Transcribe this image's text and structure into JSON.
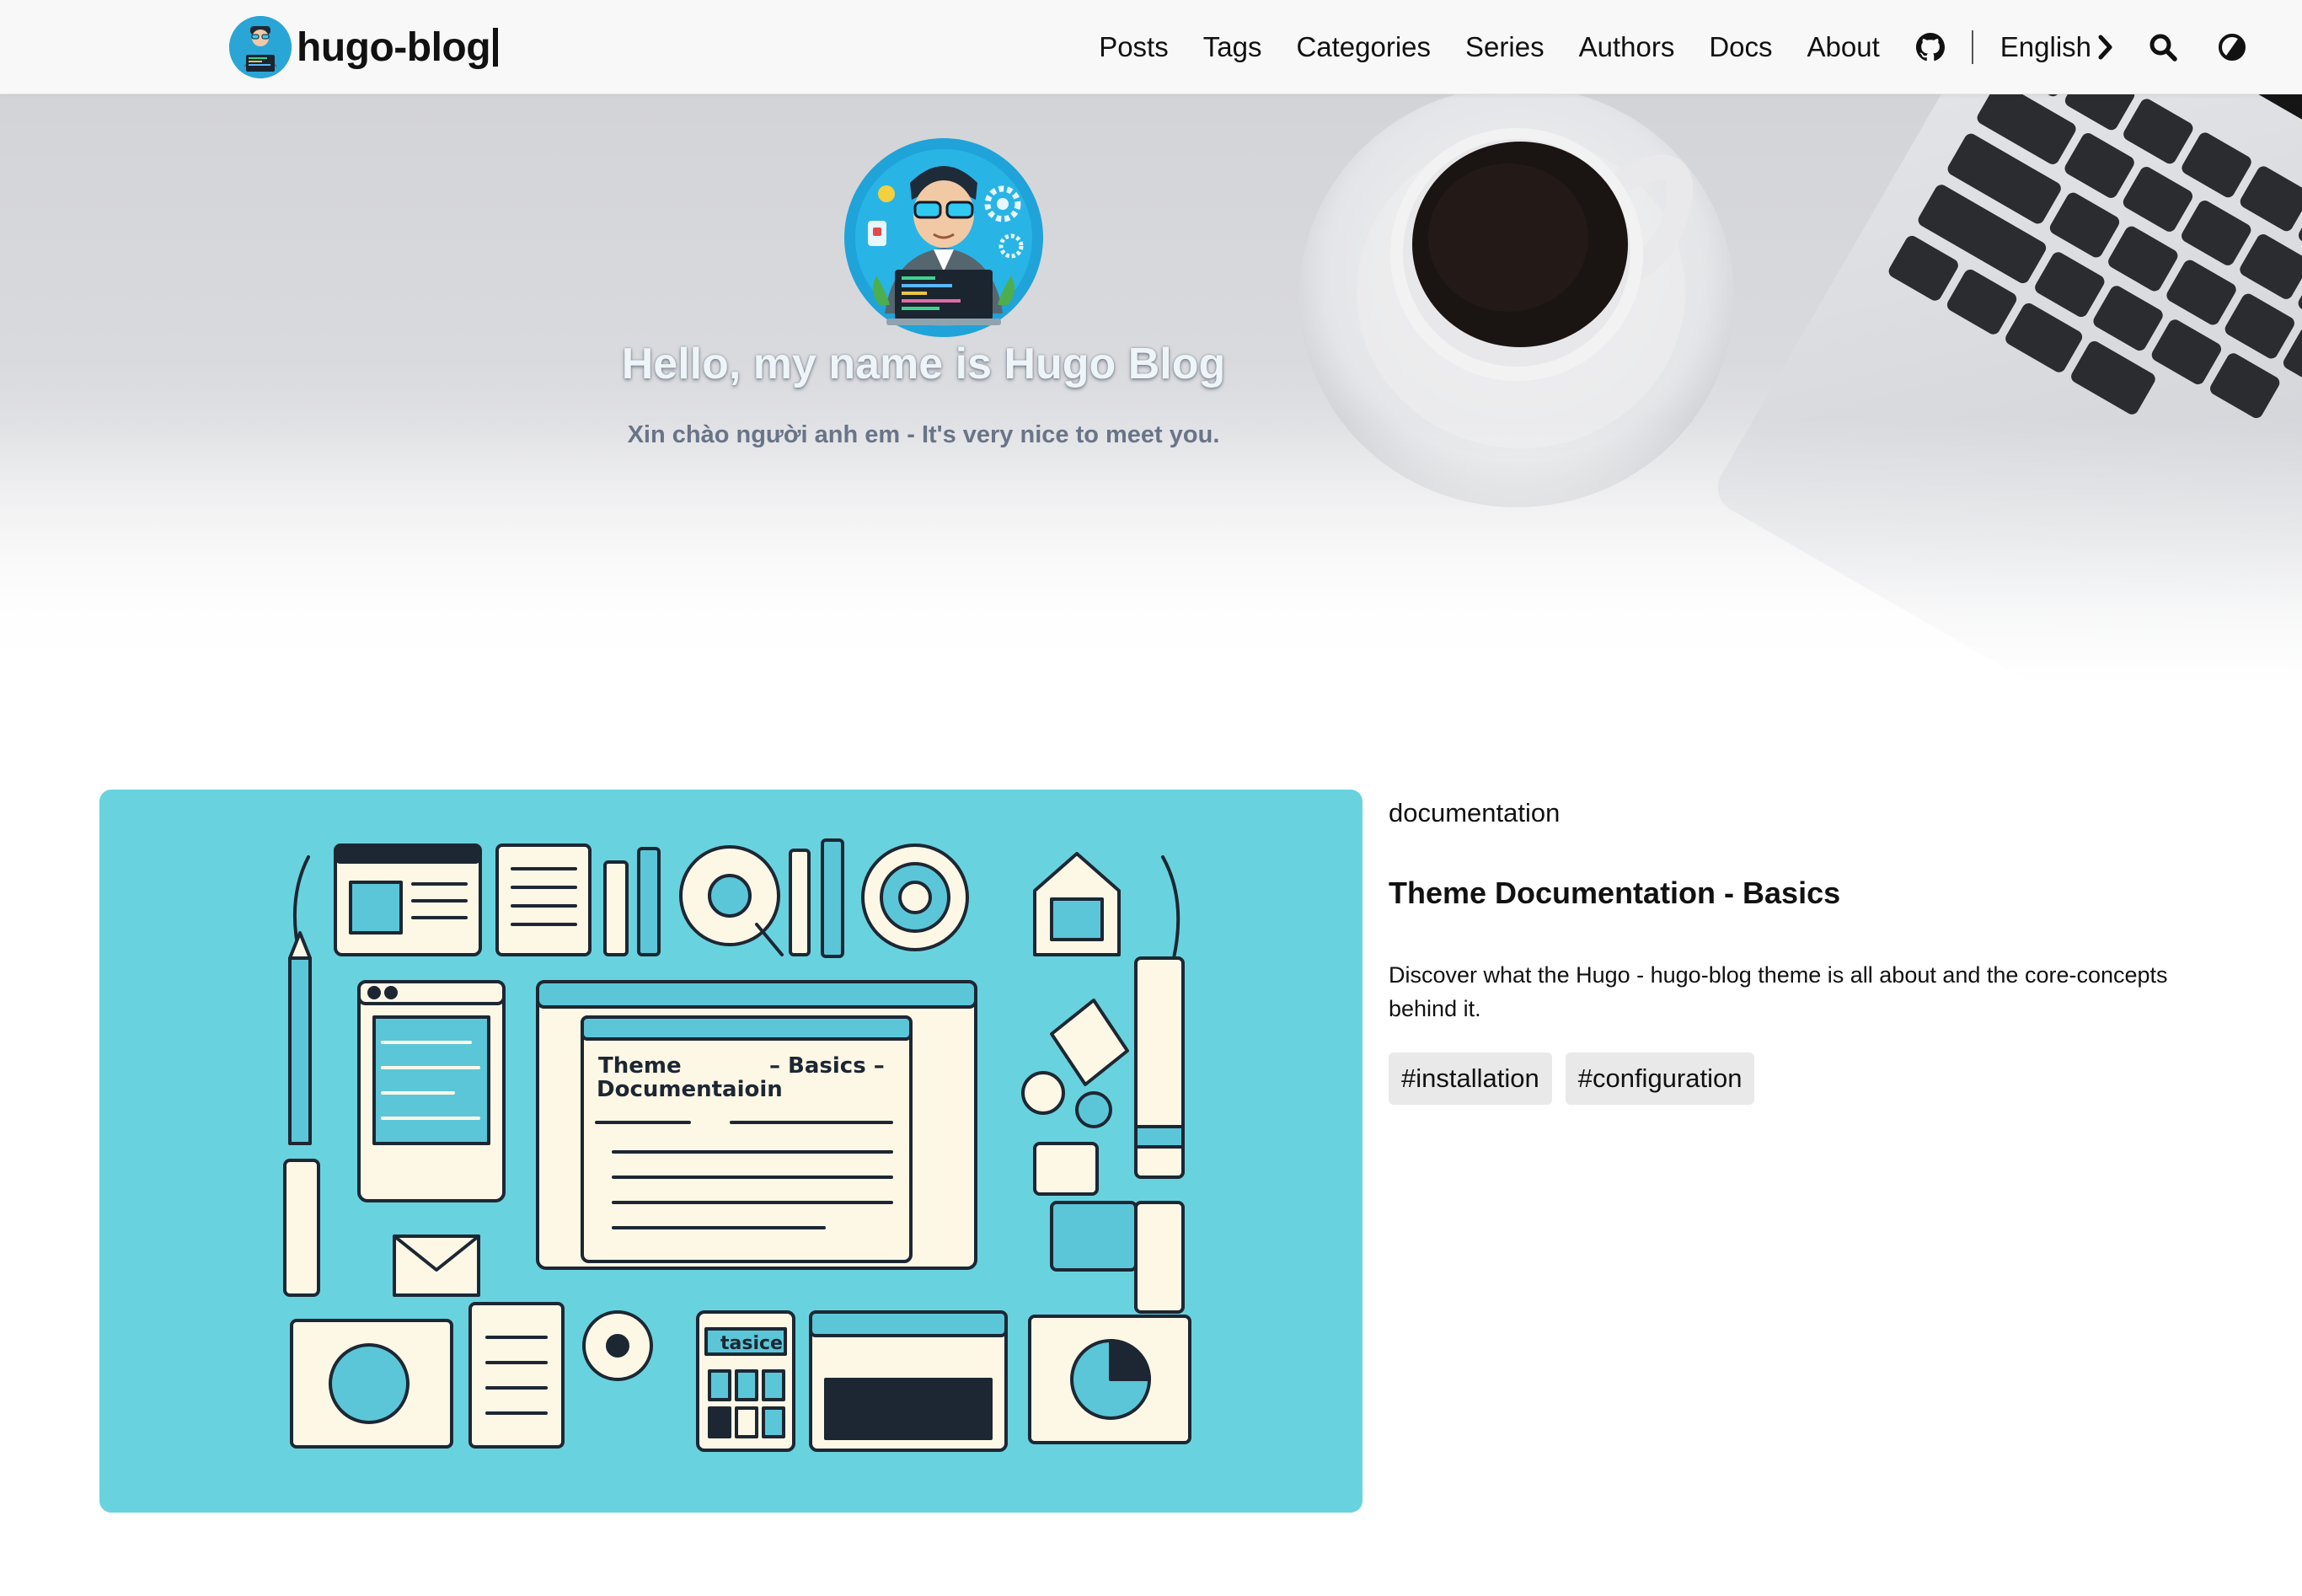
{
  "navbar": {
    "brand_title": "hugo-blog",
    "links": [
      "Posts",
      "Tags",
      "Categories",
      "Series",
      "Authors",
      "Docs",
      "About"
    ],
    "language": "English",
    "icons": [
      "github-icon",
      "chevron-right-icon",
      "search-icon",
      "theme-toggle-icon"
    ]
  },
  "hero": {
    "title": "Hello, my name is Hugo Blog",
    "subtitle": "Xin chào người anh em - It's very nice to meet you."
  },
  "post": {
    "category": "documentation",
    "title": "Theme Documentation - Basics",
    "summary": "Discover what the Hugo - hugo-blog theme is all about and the core-concepts behind it.",
    "tags": [
      "#installation",
      "#configuration"
    ],
    "image": {
      "heading_line1": "Theme",
      "heading_line2": "Documentaioin",
      "heading_right": "– Basics –",
      "card_label": "tasice",
      "background": "#68d3de"
    }
  }
}
